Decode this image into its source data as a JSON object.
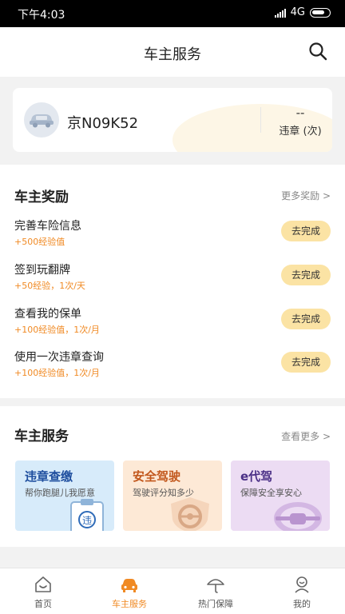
{
  "status_bar": {
    "time": "下午4:03",
    "network": "4G"
  },
  "header": {
    "title": "车主服务"
  },
  "vehicle": {
    "plate": "京N09K52",
    "violation_count": "--",
    "violation_label": "违章 (次)"
  },
  "rewards": {
    "title": "车主奖励",
    "more": "更多奖励 >",
    "tasks": [
      {
        "name": "完善车险信息",
        "bonus": "+500经验值",
        "action": "去完成"
      },
      {
        "name": "签到玩翻牌",
        "bonus": "+50经验，1次/天",
        "action": "去完成"
      },
      {
        "name": "查看我的保单",
        "bonus": "+100经验值，1次/月",
        "action": "去完成"
      },
      {
        "name": "使用一次违章查询",
        "bonus": "+100经验值，1次/月",
        "action": "去完成"
      }
    ]
  },
  "services": {
    "title": "车主服务",
    "more": "查看更多 >",
    "cards": [
      {
        "title": "违章查缴",
        "subtitle": "帮你跑腿儿我愿意",
        "badge": "违"
      },
      {
        "title": "安全驾驶",
        "subtitle": "驾驶评分知多少"
      },
      {
        "title": "e代驾",
        "subtitle": "保障安全享安心"
      }
    ]
  },
  "tabs": [
    {
      "label": "首页"
    },
    {
      "label": "车主服务"
    },
    {
      "label": "热门保障"
    },
    {
      "label": "我的"
    }
  ],
  "colors": {
    "accent": "#f08a24",
    "button_bg": "#fbe3a4",
    "title_blue": "#1f4f9f",
    "title_orange": "#c2571c",
    "title_purple": "#4a2f86"
  }
}
